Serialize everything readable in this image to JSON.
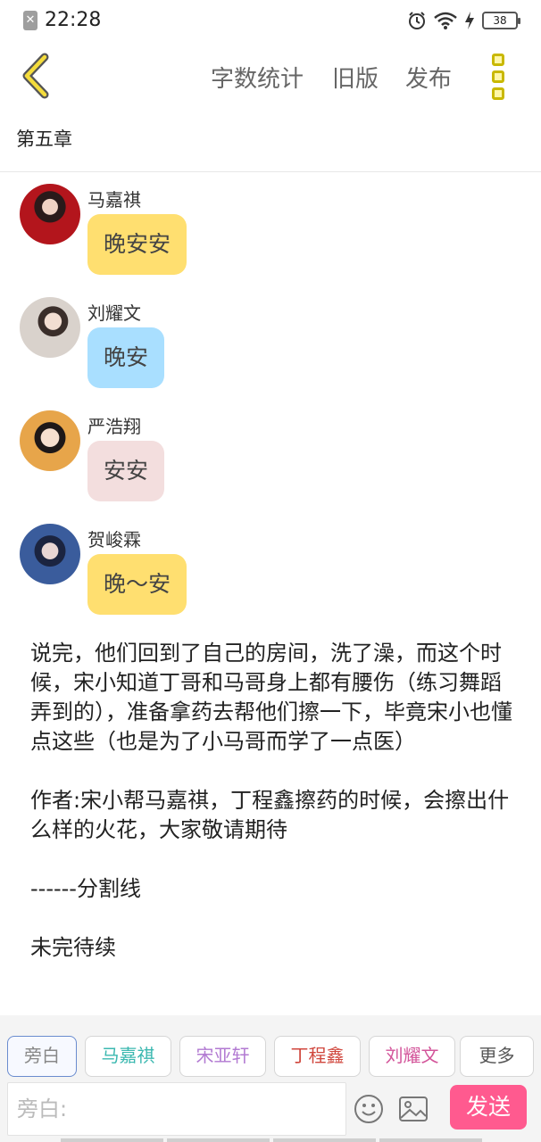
{
  "status_bar": {
    "time": "22:28",
    "battery": "38"
  },
  "toolbar": {
    "word_count_label": "字数统计",
    "old_version_label": "旧版",
    "publish_label": "发布",
    "accent_color": "#e8c81e"
  },
  "chapter": {
    "title": "第五章"
  },
  "messages": [
    {
      "sender": "马嘉祺",
      "text": "晚安安",
      "bubble_color": "#ffdf70"
    },
    {
      "sender": "刘耀文",
      "text": "晚安",
      "bubble_color": "#a9dfff"
    },
    {
      "sender": "严浩翔",
      "text": "安安",
      "bubble_color": "#f3dede"
    },
    {
      "sender": "贺峻霖",
      "text": "晚～安",
      "bubble_color": "#ffdf70"
    }
  ],
  "narration": [
    "说完，他们回到了自己的房间，洗了澡，而这个时候，宋小知道丁哥和马哥身上都有腰伤（练习舞蹈弄到的），准备拿药去帮他们擦一下，毕竟宋小也懂点这些（也是为了小马哥而学了一点医）",
    "作者:宋小帮马嘉祺，丁程鑫擦药的时候，会擦出什么样的火花，大家敬请期待",
    "------分割线",
    "未完待续"
  ],
  "role_tabs": [
    {
      "label": "旁白",
      "color": "#888888"
    },
    {
      "label": "马嘉祺",
      "color": "#3bb8b0"
    },
    {
      "label": "宋亚轩",
      "color": "#b27ad2"
    },
    {
      "label": "丁程鑫",
      "color": "#d0463c"
    },
    {
      "label": "刘耀文",
      "color": "#d3559a"
    },
    {
      "label": "更多",
      "color": "#555555"
    }
  ],
  "input": {
    "placeholder": "旁白:"
  },
  "send_label": "发送"
}
